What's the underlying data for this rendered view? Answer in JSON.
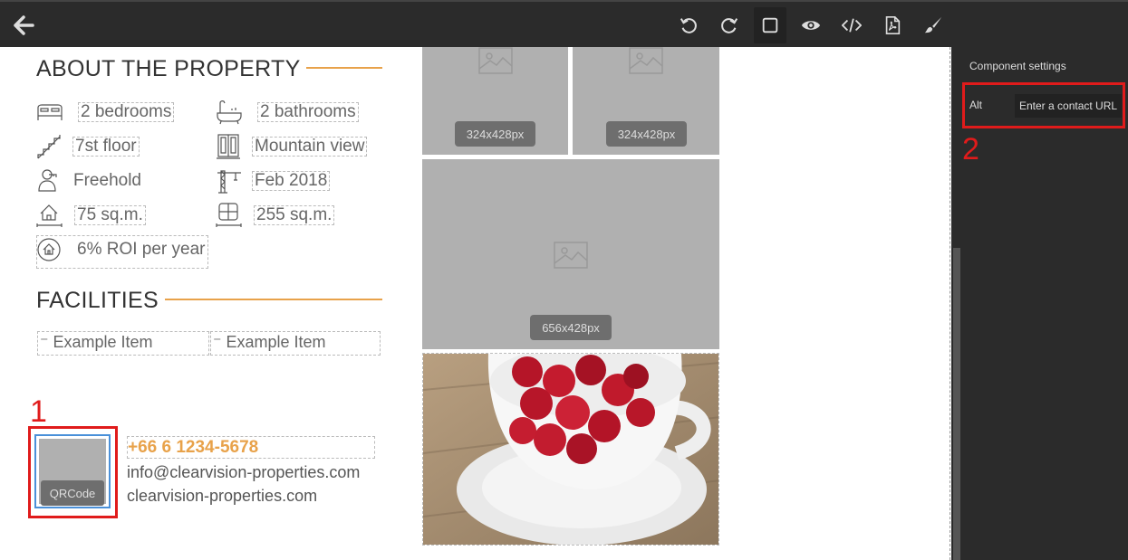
{
  "toolbar": {
    "back_icon": "arrow-left-icon",
    "tools": [
      "undo-icon",
      "redo-icon",
      "square-icon",
      "eye-icon",
      "code-icon",
      "pdf-icon",
      "brush-icon"
    ]
  },
  "panel": {
    "title": "Component settings",
    "alt_label": "Alt",
    "alt_placeholder": "Enter a contact URL"
  },
  "about": {
    "heading": "ABOUT THE PROPERTY",
    "features": [
      {
        "icon": "bed-icon",
        "text": "2 bedrooms"
      },
      {
        "icon": "bathtub-icon",
        "text": "2 bathrooms"
      },
      {
        "icon": "stairs-icon",
        "text": "7st floor"
      },
      {
        "icon": "window-icon",
        "text": "Mountain view"
      },
      {
        "icon": "key-person-icon",
        "text": "Freehold"
      },
      {
        "icon": "crane-icon",
        "text": "Feb 2018"
      },
      {
        "icon": "house-area-icon",
        "text": "75 sq.m."
      },
      {
        "icon": "floorplan-icon",
        "text": "255 sq.m."
      },
      {
        "icon": "house-roi-icon",
        "text": "6% ROI per year"
      }
    ]
  },
  "facilities": {
    "heading": "FACILITIES",
    "items": [
      "Example Item",
      "Example Item"
    ]
  },
  "contact": {
    "qr_label": "QRCode",
    "phone": "+66 6 1234-5678",
    "email": "info@clearvision-properties.com",
    "website": "clearvision-properties.com"
  },
  "images": {
    "small_1": "324x428px",
    "small_2": "324x428px",
    "large": "656x428px"
  },
  "annotations": {
    "one": "1",
    "two": "2"
  },
  "colors": {
    "accent": "#e8a24a",
    "toolbar_bg": "#2b2b2b",
    "annotation": "#e01b1b",
    "selection": "#4a90d9"
  }
}
